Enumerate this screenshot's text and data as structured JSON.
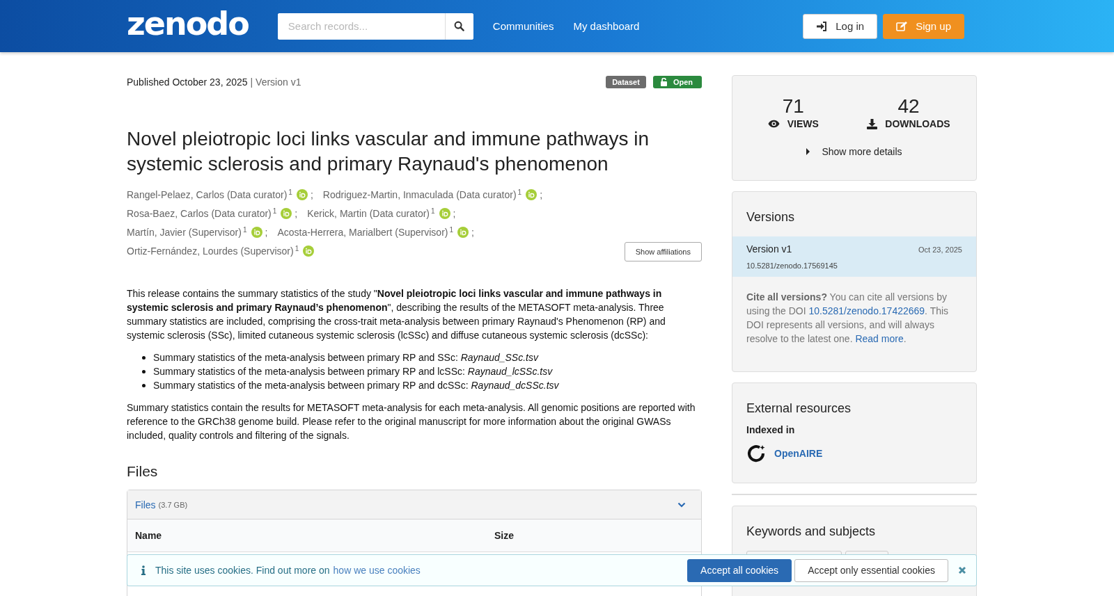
{
  "header": {
    "logo": "zenodo",
    "search": {
      "placeholder": "Search records..."
    },
    "nav": [
      "Communities",
      "My dashboard"
    ],
    "buttons": [
      {
        "kind": "login",
        "label": "Log in"
      },
      {
        "kind": "signup",
        "label": "Sign up"
      }
    ]
  },
  "record": {
    "published": "Published October 23, 2025",
    "version": "| Version v1",
    "badges": [
      {
        "kind": "type",
        "label": "Dataset"
      },
      {
        "kind": "access",
        "label": "Open"
      }
    ],
    "title": "Novel pleiotropic loci links vascular and immune pathways in systemic sclerosis and primary Raynaud's phenomenon",
    "creator_lines": [
      [
        {
          "name": "Rangel-Pelaez, Carlos (Data curator)",
          "mark": "1",
          "sep": ";"
        },
        {
          "name": "Rodriguez-Martin, Inmaculada (Data curator)",
          "mark": "1",
          "sep": ";"
        }
      ],
      [
        {
          "name": "Rosa-Baez, Carlos (Data curator)",
          "mark": "1",
          "sep": ";"
        },
        {
          "name": "Kerick, Martin (Data curator)",
          "mark": "1",
          "sep": ";"
        }
      ],
      [
        {
          "name": "Martín, Javier (Supervisor)",
          "mark": "1",
          "sep": ";"
        },
        {
          "name": "Acosta-Herrera, Marialbert (Supervisor)",
          "mark": "1",
          "sep": ";"
        }
      ],
      [
        {
          "name": "Ortiz-Fernández, Lourdes (Supervisor)",
          "mark": "1"
        }
      ]
    ],
    "affiliations_button": "Show affiliations",
    "description": [
      {
        "kind": "paragraph",
        "text": "This release contains the summary statistics of the study \"**Novel pleiotropic loci links vascular and immune pathways in systemic sclerosis and primary Raynaud’s phenomenon**\", describing the results of the METASOFT meta-analysis. Three summary statistics are included, comprising the cross-trait meta-analysis between primary Raynaud's Phenomenon (RP) and systemic sclerosis (SSc), limited cutaneous systemic sclerosis (lcSSc) and diffuse cutaneous systemic sclerosis (dcSSc):"
      },
      {
        "kind": "list",
        "items": [
          "Summary statistics of the meta-analysis between primary RP and SSc: *Raynaud_SSc.tsv*",
          "Summary statistics of the meta-analysis between primary RP and lcSSc: *Raynaud_lcSSc.tsv*",
          "Summary statistics of the meta-analysis between primary RP and dcSSc: *Raynaud_dcSSc.tsv*"
        ]
      },
      {
        "kind": "paragraph",
        "text": "Summary statistics contain the results for METASOFT meta-analysis for each meta-analysis. All genomic positions are reported with reference to the GRCh38 genome build. Please refer to the original manuscript for more information about the original GWASs included, quality controls and filtering of the signals."
      }
    ],
    "files": {
      "heading": "Files",
      "panel_title": "Files",
      "size": "(3.7 GB)",
      "expanded": true,
      "columns": [
        "Name",
        "Size"
      ]
    }
  },
  "sidebar": {
    "stats": [
      {
        "kind": "views",
        "value": "71",
        "label": "VIEWS"
      },
      {
        "kind": "downloads",
        "value": "42",
        "label": "DOWNLOADS"
      }
    ],
    "more_details": "Show more details",
    "versions": {
      "title": "Versions",
      "items": [
        {
          "label": "Version v1",
          "date": "Oct 23, 2025",
          "doi": "10.5281/zenodo.17569145",
          "selected": true
        }
      ],
      "cite_lead": "Cite all versions?",
      "cite_text": "You can cite all versions by using the DOI",
      "cite_doi": "10.5281/zenodo.17422669",
      "cite_rest": ". This DOI represents all versions, and will always resolve to the latest one.",
      "read_more": "Read more",
      "cite_end": "."
    },
    "external": {
      "title": "External resources",
      "subtitle": "Indexed in",
      "link": "OpenAIRE"
    },
    "keywords": {
      "title": "Keywords and subjects"
    }
  },
  "cookies": {
    "text": "This site uses cookies. Find out more on",
    "link": "how we use cookies",
    "accept_all": "Accept all cookies",
    "accept_essential": "Accept only essential cookies"
  }
}
